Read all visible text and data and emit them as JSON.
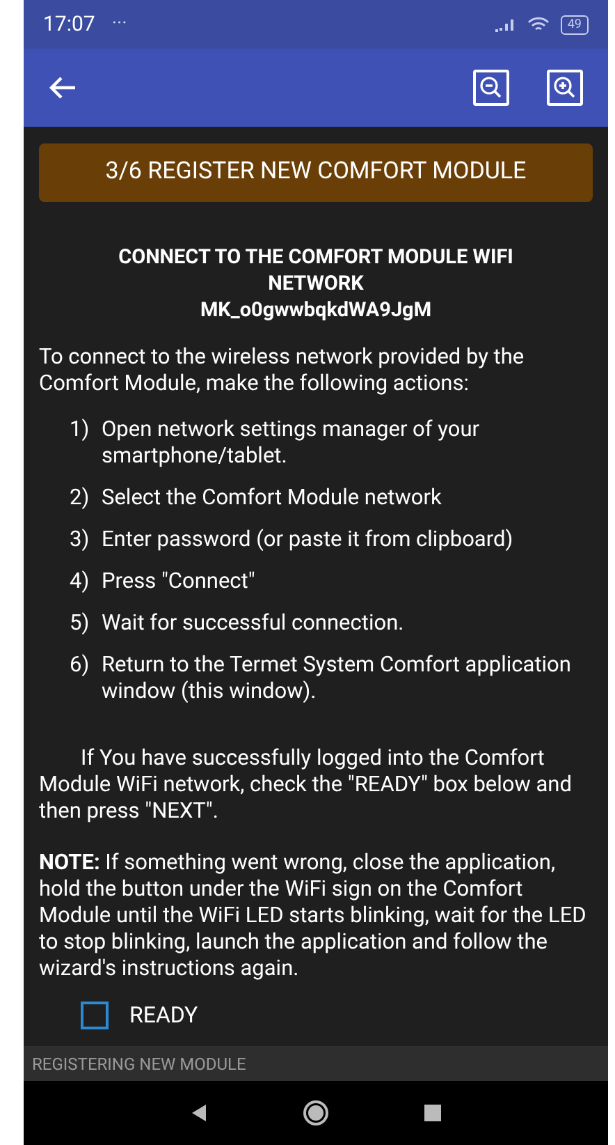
{
  "status_bar": {
    "time": "17:07",
    "dots": "···",
    "battery": "49"
  },
  "header_button": "3/6 REGISTER NEW COMFORT MODULE",
  "heading": [
    "CONNECT TO THE COMFORT MODULE WIFI NETWORK",
    "MK_o0gwwbqkdWA9JgM"
  ],
  "intro": "To connect to the wireless network provided by the Comfort Module, make the following actions:",
  "steps": [
    {
      "number": "1)",
      "text": "Open network settings manager of your smartphone/tablet."
    },
    {
      "number": "2)",
      "text": "Select the Comfort Module network"
    },
    {
      "number": "3)",
      "text": "Enter password (or paste it from clipboard)"
    },
    {
      "number": "4)",
      "text": "Press \"Connect\""
    },
    {
      "number": "5)",
      "text": "Wait for successful connection."
    },
    {
      "number": "6)",
      "text": "Return to the Termet System Comfort application window (this window)."
    }
  ],
  "instruction": "If You have successfully logged into the Comfort Module WiFi network, check the \"READY\" box below and then press \"NEXT\".",
  "note": "**NOTE:** If something went wrong, close the application, hold the button under the WiFi sign on the Comfort Module until the WiFi LED starts blinking, wait for the LED to stop blinking, launch the application and follow the wizard's instructions again.",
  "ready_checkbox": {
    "label": "READY",
    "checked": false
  },
  "footer": "REGISTERING NEW MODULE"
}
